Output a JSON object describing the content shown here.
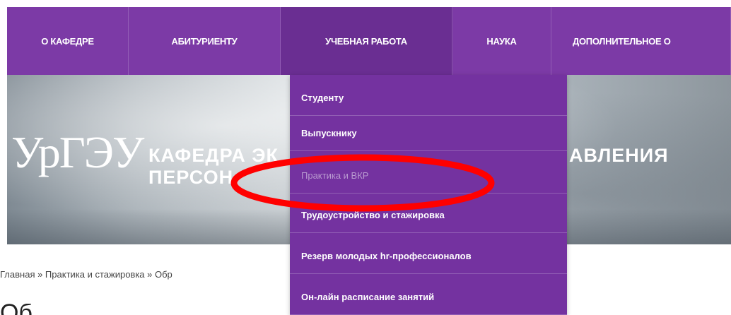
{
  "nav": {
    "items": [
      {
        "label": "О КАФЕДРЕ"
      },
      {
        "label": "АБИТУРИЕНТУ"
      },
      {
        "label": "УЧЕБНАЯ РАБОТА"
      },
      {
        "label": "НАУКА"
      },
      {
        "label": "ДОПОЛНИТЕЛЬНОЕ О"
      }
    ]
  },
  "banner": {
    "logo_text": "УрГЭУ",
    "line1_left": "КАФЕДРА ЭК",
    "line1_right": "АВЛЕНИЯ",
    "line2": "ПЕРСОН"
  },
  "dropdown": {
    "items": [
      {
        "label": "Студенту"
      },
      {
        "label": "Выпускнику"
      },
      {
        "label": "Практика и ВКР"
      },
      {
        "label": "Трудоустройство и стажировка"
      },
      {
        "label": "Резерв молодых hr-профессионалов"
      },
      {
        "label": "Он-лайн расписание занятий"
      }
    ]
  },
  "breadcrumb": "Главная » Практика и стажировка » Обр",
  "page_heading": "Об",
  "colors": {
    "nav_bg": "#7c3aa6",
    "dropdown_bg": "#7432a0",
    "highlight_ring": "#ff0000"
  }
}
